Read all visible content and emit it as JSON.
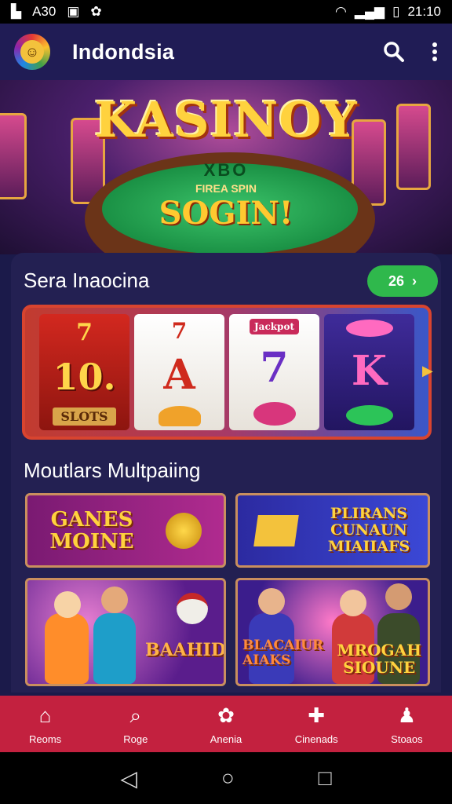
{
  "status_bar": {
    "time_left": "A30",
    "time_right": "21:10"
  },
  "app_bar": {
    "title": "Indondsia"
  },
  "hero": {
    "title": "KASINOY",
    "table_text": "XBO",
    "subtitle": "FIREA SPIN",
    "button_text": "SOGIN!"
  },
  "section_featured": {
    "title": "Sera Inaocina",
    "badge": "26"
  },
  "slot": {
    "reel1_top": "7",
    "reel1_main": "10.",
    "reel1_bottom": "SLOTS",
    "reel2_top": "7",
    "reel2_main": "A",
    "reel3_top": "Jackpot",
    "reel3_main": "7",
    "reel4_main": "K"
  },
  "section_multi": {
    "title": "Moutlars Multpaiing"
  },
  "cards": [
    {
      "line1": "GANES",
      "line2": "MOINE"
    },
    {
      "line1": "PLIRANS",
      "line2": "CUNAUN",
      "line3": "MIAIIAFS"
    },
    {
      "line1": "BAAHIDS"
    },
    {
      "line1": "BLACAIUR",
      "line2": "AIAKS",
      "line3": "MROGAH",
      "line4": "SIOUNE"
    }
  ],
  "bottom_nav": [
    {
      "label": "Reoms",
      "icon": "home-icon"
    },
    {
      "label": "Roge",
      "icon": "search-icon"
    },
    {
      "label": "Anenia",
      "icon": "casino-chip-icon"
    },
    {
      "label": "Cinenads",
      "icon": "gift-icon"
    },
    {
      "label": "Stoaos",
      "icon": "profile-icon"
    }
  ],
  "colors": {
    "accent": "#2fb84c",
    "nav": "#c3213f",
    "bg": "#1b1a4a"
  }
}
